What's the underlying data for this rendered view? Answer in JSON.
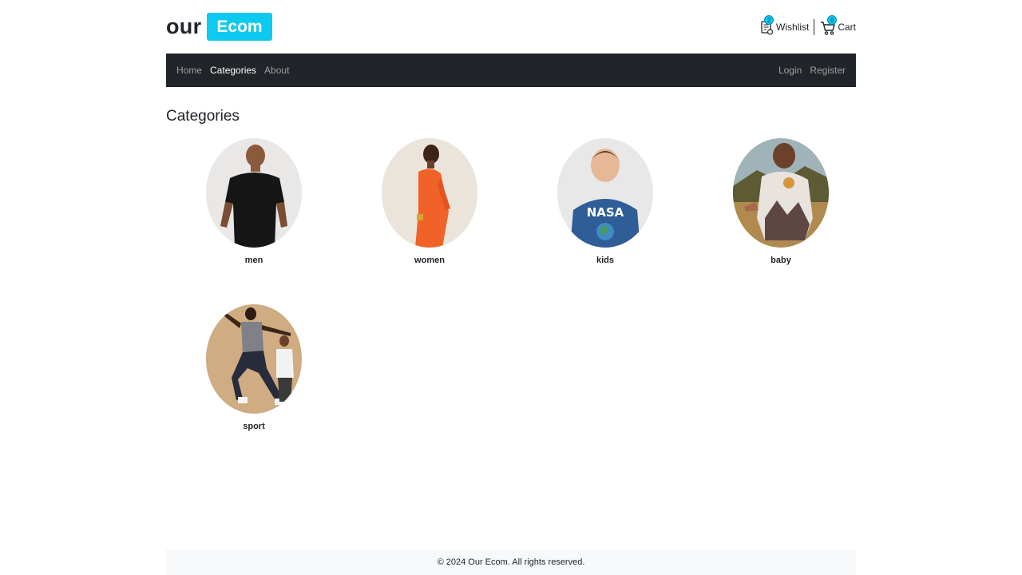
{
  "brand": {
    "prefix": "our",
    "badge": "Ecom"
  },
  "header": {
    "wishlist": {
      "label": "Wishlist",
      "count": "2",
      "icon": "wishlist-icon"
    },
    "cart": {
      "label": "Cart",
      "count": "6",
      "icon": "cart-icon"
    }
  },
  "nav": {
    "left": [
      {
        "label": "Home",
        "active": false
      },
      {
        "label": "Categories",
        "active": true
      },
      {
        "label": "About",
        "active": false
      }
    ],
    "right": [
      {
        "label": "Login"
      },
      {
        "label": "Register"
      }
    ]
  },
  "page": {
    "title": "Categories"
  },
  "categories": [
    {
      "name": "men"
    },
    {
      "name": "women"
    },
    {
      "name": "kids"
    },
    {
      "name": "baby"
    },
    {
      "name": "sport"
    }
  ],
  "footer": {
    "text": "© 2024 Our Ecom. All rights reserved."
  },
  "colors": {
    "accent": "#0dcaf0",
    "navbar": "#212529",
    "footer_bg": "#f8f9fa"
  }
}
